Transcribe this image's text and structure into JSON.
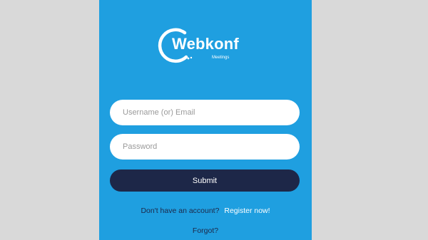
{
  "logo": {
    "brand": "Webkonf",
    "tagline": "Meetings",
    "icon": "swoosh-logo-icon"
  },
  "form": {
    "username_placeholder": "Username (or) Email",
    "username_value": "",
    "password_placeholder": "Password",
    "password_value": "",
    "submit_label": "Submit"
  },
  "links": {
    "register_question": "Don't have an account?",
    "register_label": "Register now!",
    "forgot_label": "Forgot?"
  },
  "colors": {
    "background": "#1f9fe0",
    "button": "#1d2748",
    "page_gutter": "#d9d9d9"
  }
}
